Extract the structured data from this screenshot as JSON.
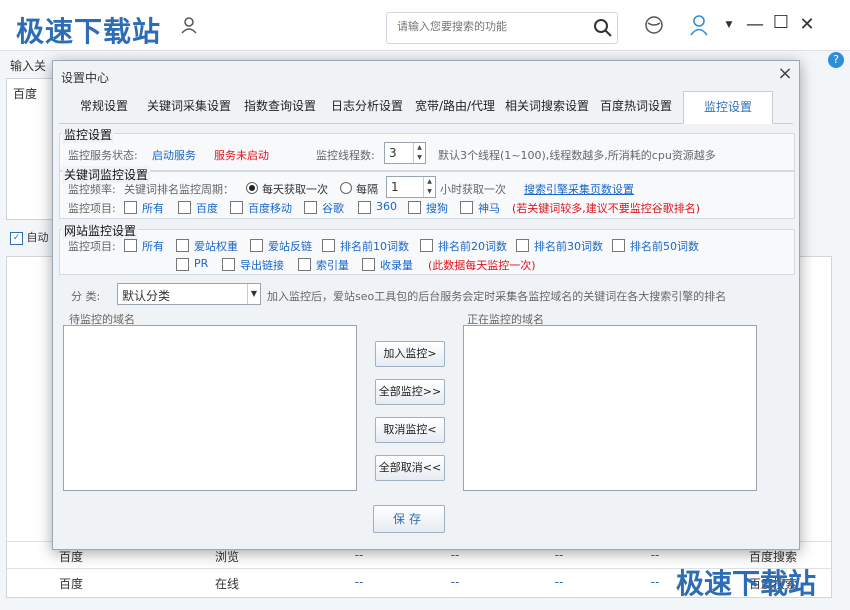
{
  "app": {
    "watermark": "极速下载站",
    "search_placeholder": "请输入您要搜索的功能",
    "bg_input_label": "输入关",
    "bg_textarea_value": "百度",
    "auto_label": "自动",
    "help": "?",
    "table_rows": [
      {
        "c1": "百度",
        "c2": "浏览",
        "c3": "--",
        "c4": "--",
        "c5": "--",
        "c6": "--",
        "c7": "百度搜索"
      },
      {
        "c1": "百度",
        "c2": "在线",
        "c3": "--",
        "c4": "--",
        "c5": "--",
        "c6": "--",
        "c7": "百度搜索"
      }
    ]
  },
  "dialog": {
    "title": "设置中心",
    "close": "×",
    "tabs": [
      "常规设置",
      "关键词采集设置",
      "指数查询设置",
      "日志分析设置",
      "宽带/路由/代理",
      "相关词搜索设置",
      "百度热词设置",
      "监控设置"
    ],
    "monitor": {
      "title": "监控设置",
      "status_label": "监控服务状态:",
      "start_link": "启动服务",
      "status_value": "服务未启动",
      "threads_label": "监控线程数:",
      "threads_value": "3",
      "threads_note": "默认3个线程(1~100),线程数越多,所消耗的cpu资源越多"
    },
    "keyword": {
      "title": "关键词监控设置",
      "freq_label": "监控频率:",
      "cycle_label": "关键词排名监控周期：",
      "daily": "每天获取一次",
      "every": "每隔",
      "hours_value": "1",
      "hours_suffix": "小时获取一次",
      "engine_link": "搜索引擎采集页数设置",
      "items_label": "监控项目:",
      "items": [
        "所有",
        "百度",
        "百度移动",
        "谷歌",
        "360",
        "搜狗",
        "神马"
      ],
      "warning": "(若关键词较多,建议不要监控谷歌排名)"
    },
    "site": {
      "title": "网站监控设置",
      "items_label": "监控项目:",
      "items_row1": [
        "所有",
        "爱站权重",
        "爱站反链",
        "排名前10词数",
        "排名前20词数",
        "排名前30词数",
        "排名前50词数"
      ],
      "items_row2": [
        "PR",
        "导出链接",
        "索引量",
        "收录量"
      ],
      "warning": "(此数据每天监控一次)"
    },
    "category": {
      "label": "分 类:",
      "value": "默认分类",
      "note": "加入监控后，爱站seo工具包的后台服务会定时采集各监控域名的关键词在各大搜索引擎的排名"
    },
    "pending_title": "待监控的域名",
    "active_title": "正在监控的域名",
    "buttons": {
      "add": "加入监控>",
      "add_all": "全部监控>>",
      "cancel": "取消监控<",
      "cancel_all": "全部取消<<",
      "save": "保存"
    }
  }
}
